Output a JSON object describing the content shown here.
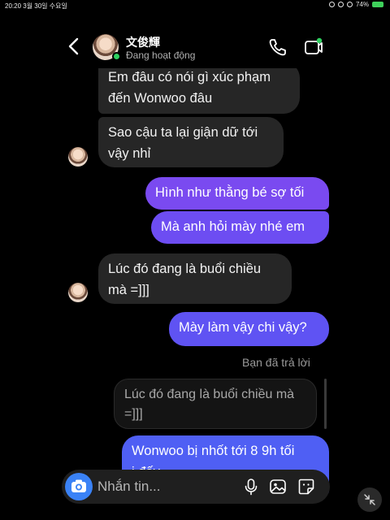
{
  "status_bar": {
    "time_date": "20:20  3월 30일 수요일",
    "battery": "74%"
  },
  "header": {
    "contact_name": "文俊輝",
    "contact_status": "Đang hoạt động"
  },
  "messages": [
    {
      "text_line1": "Em đâu có nói gì xúc phạm",
      "text_line2": "đến Wonwoo đâu"
    },
    {
      "text_line1": "Sao cậu ta lại giận dữ tới",
      "text_line2": "vậy nhỉ"
    },
    {
      "text": "Hình như thằng bé sợ tối"
    },
    {
      "text": "Mà anh hỏi mày nhé em"
    },
    {
      "text_line1": "Lúc đó đang là buổi chiều",
      "text_line2": "mà =]]]"
    },
    {
      "text": "Mày làm vậy chi vậy?"
    }
  ],
  "reply": {
    "label": "Bạn đã trả lời",
    "quote_line1": "Lúc đó đang là buổi chiều mà",
    "quote_line2": "=]]]",
    "text_line1": "Wonwoo bị nhốt tới 8 9h tối",
    "text_line2": "ị đấy"
  },
  "composer": {
    "placeholder": "Nhắn tin..."
  },
  "colors": {
    "accent": "#3a82f6",
    "online": "#2fd160",
    "incoming_bubble": "#262626",
    "outgoing_gradient": [
      "#7a4af0",
      "#4f5ff4"
    ]
  }
}
